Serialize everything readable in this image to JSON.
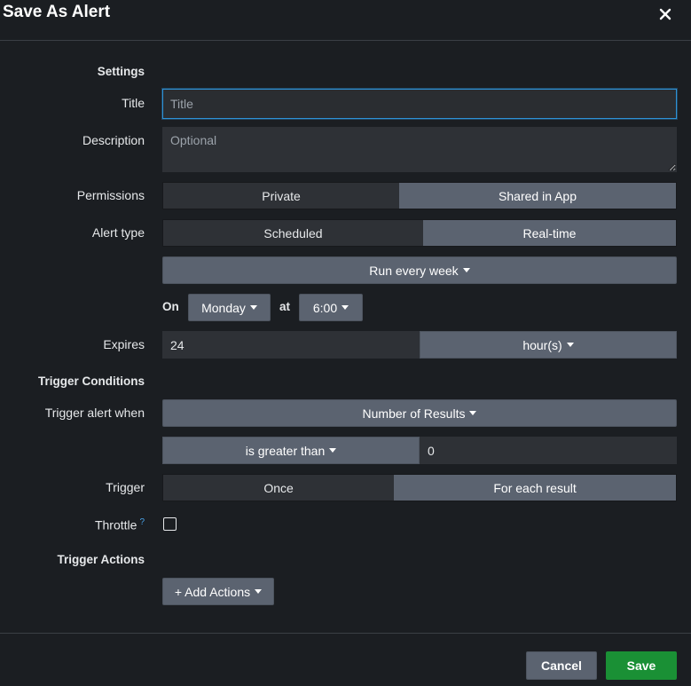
{
  "dialog": {
    "title": "Save As Alert",
    "close_icon": "close-icon"
  },
  "settings": {
    "heading": "Settings",
    "title_label": "Title",
    "title_placeholder": "Title",
    "title_value": "",
    "description_label": "Description",
    "description_placeholder": "Optional",
    "permissions_label": "Permissions",
    "permissions_options": [
      "Private",
      "Shared in App"
    ],
    "permissions_selected": "Private",
    "alert_type_label": "Alert type",
    "alert_type_options": [
      "Scheduled",
      "Real-time"
    ],
    "alert_type_selected": "Scheduled",
    "schedule_select": "Run every week",
    "on_label": "On",
    "day_select": "Monday",
    "at_label": "at",
    "time_select": "6:00",
    "expires_label": "Expires",
    "expires_value": "24",
    "expires_unit": "hour(s)"
  },
  "trigger_conditions": {
    "heading": "Trigger Conditions",
    "trigger_when_label": "Trigger alert when",
    "trigger_when_select": "Number of Results",
    "comparison_select": "is greater than",
    "comparison_value": "0",
    "trigger_label": "Trigger",
    "trigger_options": [
      "Once",
      "For each result"
    ],
    "trigger_selected": "Once",
    "throttle_label": "Throttle",
    "throttle_help": "?",
    "throttle_checked": false
  },
  "trigger_actions": {
    "heading": "Trigger Actions",
    "add_actions_label": "+ Add Actions"
  },
  "footer": {
    "cancel_label": "Cancel",
    "save_label": "Save"
  },
  "colors": {
    "background": "#1b1e22",
    "input_bg": "#2e3136",
    "button_gray": "#5b6370",
    "focus_blue": "#2e91d6",
    "save_green": "#1a9035"
  }
}
